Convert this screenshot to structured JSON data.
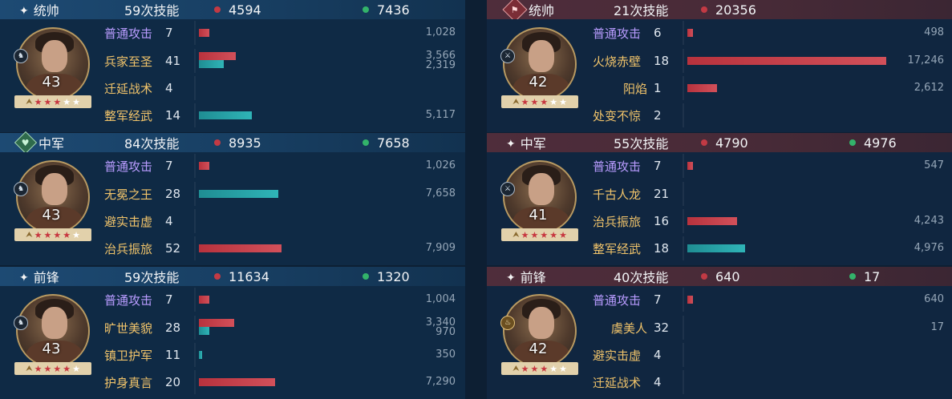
{
  "left": [
    {
      "role": "统帅",
      "role_icon": "sparkle-icon",
      "skills": "59次技能",
      "damage": "4594",
      "heal": "7436",
      "level": "43",
      "stars_red": 3,
      "stars_white": 2,
      "badge": "mount-icon",
      "rows": [
        {
          "name": "普通攻击",
          "count": "7",
          "color": "purple",
          "bars": [
            {
              "c": "red",
              "f": 0.06
            }
          ],
          "nums": [
            "1,028"
          ]
        },
        {
          "name": "兵家至圣",
          "count": "41",
          "color": "gold",
          "bars": [
            {
              "c": "red",
              "f": 0.21
            },
            {
              "c": "teal",
              "f": 0.14
            }
          ],
          "nums": [
            "3,566",
            "2,319"
          ]
        },
        {
          "name": "迁延战术",
          "count": "4",
          "color": "gold",
          "bars": [],
          "nums": []
        },
        {
          "name": "整军经武",
          "count": "14",
          "color": "gold",
          "bars": [
            {
              "c": "teal",
              "f": 0.3
            }
          ],
          "nums": [
            "5,117"
          ]
        }
      ]
    },
    {
      "role": "中军",
      "role_icon": "shield-heart-icon",
      "skills": "84次技能",
      "damage": "8935",
      "heal": "7658",
      "level": "43",
      "stars_red": 4,
      "stars_white": 1,
      "badge": "mount-icon",
      "rows": [
        {
          "name": "普通攻击",
          "count": "7",
          "color": "purple",
          "bars": [
            {
              "c": "red",
              "f": 0.06
            }
          ],
          "nums": [
            "1,026"
          ]
        },
        {
          "name": "无冕之王",
          "count": "28",
          "color": "gold",
          "bars": [
            {
              "c": "teal",
              "f": 0.45
            }
          ],
          "nums": [
            "7,658"
          ]
        },
        {
          "name": "避实击虚",
          "count": "4",
          "color": "gold",
          "bars": [],
          "nums": []
        },
        {
          "name": "治兵振旅",
          "count": "52",
          "color": "gold",
          "bars": [
            {
              "c": "red",
              "f": 0.47
            }
          ],
          "nums": [
            "7,909"
          ]
        }
      ]
    },
    {
      "role": "前锋",
      "role_icon": "sparkle-icon",
      "skills": "59次技能",
      "damage": "11634",
      "heal": "1320",
      "level": "43",
      "stars_red": 4,
      "stars_white": 1,
      "badge": "mount-icon",
      "rows": [
        {
          "name": "普通攻击",
          "count": "7",
          "color": "purple",
          "bars": [
            {
              "c": "red",
              "f": 0.06
            }
          ],
          "nums": [
            "1,004"
          ]
        },
        {
          "name": "旷世美貌",
          "count": "28",
          "color": "gold",
          "bars": [
            {
              "c": "red",
              "f": 0.2
            },
            {
              "c": "teal",
              "f": 0.06
            }
          ],
          "nums": [
            "3,340",
            "970"
          ]
        },
        {
          "name": "镇卫护军",
          "count": "11",
          "color": "gold",
          "bars": [
            {
              "c": "teal",
              "f": 0.02
            }
          ],
          "nums": [
            "350"
          ]
        },
        {
          "name": "护身真言",
          "count": "20",
          "color": "gold",
          "bars": [
            {
              "c": "red",
              "f": 0.43
            }
          ],
          "nums": [
            "7,290"
          ]
        }
      ]
    }
  ],
  "right": [
    {
      "role": "统帅",
      "role_icon": "banner-icon",
      "skills": "21次技能",
      "damage": "20356",
      "heal": "",
      "level": "42",
      "stars_red": 3,
      "stars_white": 2,
      "badge": "sword-icon",
      "rows": [
        {
          "name": "普通攻击",
          "count": "6",
          "color": "purple",
          "bars": [
            {
              "c": "red",
              "f": 0.03
            }
          ],
          "nums": [
            "498"
          ]
        },
        {
          "name": "火烧赤壁",
          "count": "18",
          "color": "gold",
          "bars": [
            {
              "c": "red",
              "f": 1.0
            }
          ],
          "nums": [
            "17,246"
          ]
        },
        {
          "name": "阳焰",
          "count": "1",
          "color": "gold",
          "rightal": true,
          "bars": [
            {
              "c": "red",
              "f": 0.15
            }
          ],
          "nums": [
            "2,612"
          ]
        },
        {
          "name": "处变不惊",
          "count": "2",
          "color": "gold",
          "bars": [],
          "nums": []
        }
      ]
    },
    {
      "role": "中军",
      "role_icon": "sparkle-icon",
      "skills": "55次技能",
      "damage": "4790",
      "heal": "4976",
      "level": "41",
      "stars_red": 5,
      "stars_white": 0,
      "badge": "sword-icon",
      "rows": [
        {
          "name": "普通攻击",
          "count": "7",
          "color": "purple",
          "bars": [
            {
              "c": "red",
              "f": 0.03
            }
          ],
          "nums": [
            "547"
          ]
        },
        {
          "name": "千古人龙",
          "count": "21",
          "color": "gold",
          "bars": [],
          "nums": []
        },
        {
          "name": "治兵振旅",
          "count": "16",
          "color": "gold",
          "bars": [
            {
              "c": "red",
              "f": 0.25
            }
          ],
          "nums": [
            "4,243"
          ]
        },
        {
          "name": "整军经武",
          "count": "18",
          "color": "gold",
          "bars": [
            {
              "c": "teal",
              "f": 0.29
            }
          ],
          "nums": [
            "4,976"
          ]
        }
      ]
    },
    {
      "role": "前锋",
      "role_icon": "sparkle-icon",
      "skills": "40次技能",
      "damage": "640",
      "heal": "17",
      "level": "42",
      "stars_red": 3,
      "stars_white": 2,
      "badge": "lamp-icon",
      "rows": [
        {
          "name": "普通攻击",
          "count": "7",
          "color": "purple",
          "bars": [
            {
              "c": "red",
              "f": 0.03
            }
          ],
          "nums": [
            "640"
          ]
        },
        {
          "name": "虞美人",
          "count": "32",
          "color": "gold",
          "rightal": true,
          "bars": [],
          "nums": [
            "17"
          ]
        },
        {
          "name": "避实击虚",
          "count": "4",
          "color": "gold",
          "bars": [],
          "nums": []
        },
        {
          "name": "迁延战术",
          "count": "4",
          "color": "gold",
          "bars": [],
          "nums": []
        }
      ]
    }
  ]
}
